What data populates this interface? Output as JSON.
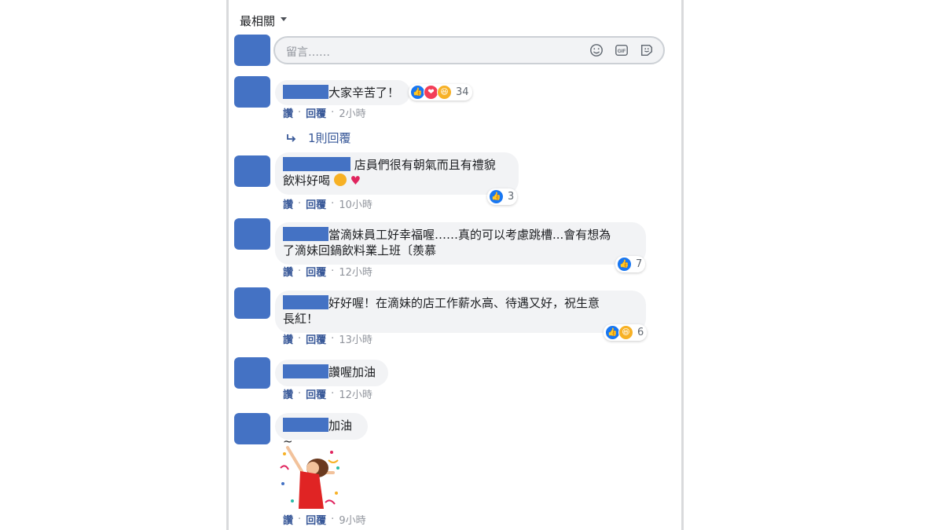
{
  "sort_label": "最相關",
  "composer": {
    "placeholder": "留言……"
  },
  "actions": {
    "like": "讚",
    "reply": "回覆"
  },
  "comments": [
    {
      "text": "大家辛苦了！",
      "reactions": [
        "like",
        "love",
        "haha"
      ],
      "count": "34",
      "time": "2小時",
      "replies_link": "1則回覆"
    },
    {
      "line1": " 店員們很有朝氣而且有禮貌",
      "line2": "飲料好喝",
      "reactions": [
        "like"
      ],
      "count": "3",
      "time": "10小時"
    },
    {
      "line1": "當滴妹員工好幸福喔……真的可以考慮跳槽...會有想為",
      "line2": "了滴妹回鍋飲料業上班〔羨慕",
      "reactions": [
        "like"
      ],
      "count": "7",
      "time": "12小時"
    },
    {
      "line1": "好好喔！在滴妹的店工作薪水高、待遇又好，祝生意",
      "line2": "長紅！",
      "reactions": [
        "like",
        "haha"
      ],
      "count": "6",
      "time": "13小時"
    },
    {
      "text": "讚喔加油",
      "time": "12小時"
    },
    {
      "text": "加油~",
      "time": "9小時"
    }
  ]
}
